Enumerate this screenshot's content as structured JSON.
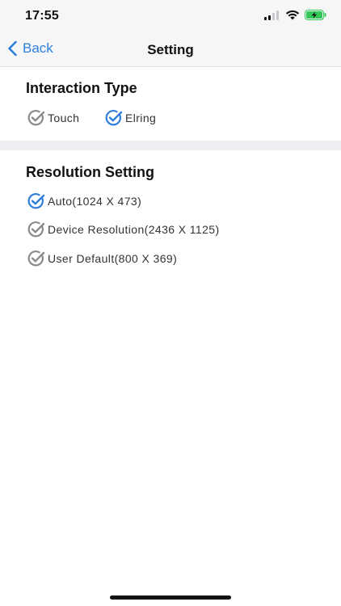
{
  "status_bar": {
    "time": "17:55"
  },
  "nav": {
    "back_label": "Back",
    "title": "Setting"
  },
  "interaction": {
    "title": "Interaction Type",
    "options": [
      {
        "label": "Touch",
        "selected": false
      },
      {
        "label": "Elring",
        "selected": true
      }
    ]
  },
  "resolution": {
    "title": "Resolution Setting",
    "options": [
      {
        "label": "Auto(1024 X 473)",
        "selected": true
      },
      {
        "label": "Device Resolution(2436 X 1125)",
        "selected": false
      },
      {
        "label": "User Default(800 X 369)",
        "selected": false
      }
    ]
  },
  "colors": {
    "accent": "#2f7ddb",
    "unselected": "#8a8a8a",
    "battery": "#34c759"
  }
}
